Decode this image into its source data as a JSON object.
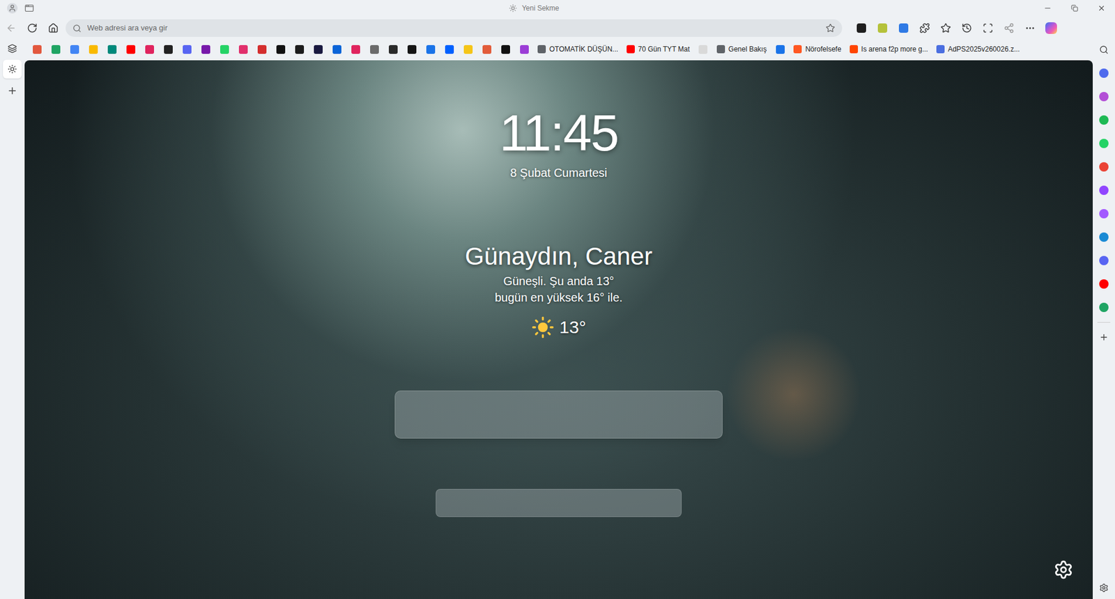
{
  "window": {
    "title": "Yeni Sekme"
  },
  "address_bar": {
    "placeholder": "Web adresi ara veya gir"
  },
  "extensions": [
    {
      "color": "#1f1f1f"
    },
    {
      "color": "#b5c23a"
    },
    {
      "color": "#2f7ae5"
    }
  ],
  "vertical_tabs": [
    {
      "selected": true
    }
  ],
  "bookmarks": [
    {
      "kind": "icon",
      "color": "#e2583e"
    },
    {
      "kind": "icon",
      "color": "#1fa463"
    },
    {
      "kind": "icon",
      "color": "#4285f4"
    },
    {
      "kind": "icon",
      "color": "#f9ba00"
    },
    {
      "kind": "icon",
      "color": "#00897b"
    },
    {
      "kind": "icon",
      "color": "#ff0000"
    },
    {
      "kind": "icon",
      "color": "#e0245e"
    },
    {
      "kind": "icon",
      "color": "#222222"
    },
    {
      "kind": "icon",
      "color": "#5865f2"
    },
    {
      "kind": "icon",
      "color": "#7719aa"
    },
    {
      "kind": "icon",
      "color": "#25d366"
    },
    {
      "kind": "icon",
      "color": "#e1306c"
    },
    {
      "kind": "icon",
      "color": "#d42e2e"
    },
    {
      "kind": "icon",
      "color": "#111111"
    },
    {
      "kind": "icon",
      "color": "#1c1c1c"
    },
    {
      "kind": "icon",
      "color": "#1a1a40"
    },
    {
      "kind": "icon",
      "color": "#0a64d8"
    },
    {
      "kind": "icon",
      "color": "#e0245e"
    },
    {
      "kind": "icon",
      "color": "#6b6b6b"
    },
    {
      "kind": "icon",
      "color": "#2a2a2a"
    },
    {
      "kind": "icon",
      "color": "#151515"
    },
    {
      "kind": "icon",
      "color": "#1a73e8"
    },
    {
      "kind": "icon",
      "color": "#0061ff"
    },
    {
      "kind": "icon",
      "color": "#f5c518"
    },
    {
      "kind": "icon",
      "color": "#e25c3a"
    },
    {
      "kind": "icon",
      "color": "#111111"
    },
    {
      "kind": "icon",
      "color": "#9b3dd6"
    },
    {
      "kind": "labeled",
      "label": "OTOMATİK DÜŞÜN...",
      "color": "#5f6368"
    },
    {
      "kind": "labeled",
      "label": "70 Gün TYT Mat",
      "color": "#ff0000"
    },
    {
      "kind": "icon",
      "color": "#d9d9d9"
    },
    {
      "kind": "labeled",
      "label": "Genel Bakış",
      "color": "#5f6368"
    },
    {
      "kind": "icon",
      "color": "#1a73e8"
    },
    {
      "kind": "labeled",
      "label": "Nörofelsefe",
      "color": "#ff5722"
    },
    {
      "kind": "labeled",
      "label": "Is arena f2p more g...",
      "color": "#ff4500"
    },
    {
      "kind": "labeled",
      "label": "AdPS2025v260026.z...",
      "color": "#4a6ee0"
    }
  ],
  "sidebar_apps": [
    {
      "color": "#4f6bed"
    },
    {
      "color": "#b34fd6"
    },
    {
      "color": "#1db954"
    },
    {
      "color": "#25d366"
    },
    {
      "color": "#ea4335"
    },
    {
      "color": "#9146ff"
    },
    {
      "color": "#a259ff"
    },
    {
      "color": "#1a8ad4"
    },
    {
      "color": "#5865f2"
    },
    {
      "color": "#ff0000"
    },
    {
      "color": "#1fa463"
    }
  ],
  "clock": {
    "time": "11:45",
    "date": "8 Şubat Cumartesi"
  },
  "greeting": "Günaydın, Caner",
  "weather": {
    "line1": "Güneşli. Şu anda 13°",
    "line2": "bugün en yüksek 16° ile.",
    "temperature": "13°"
  }
}
